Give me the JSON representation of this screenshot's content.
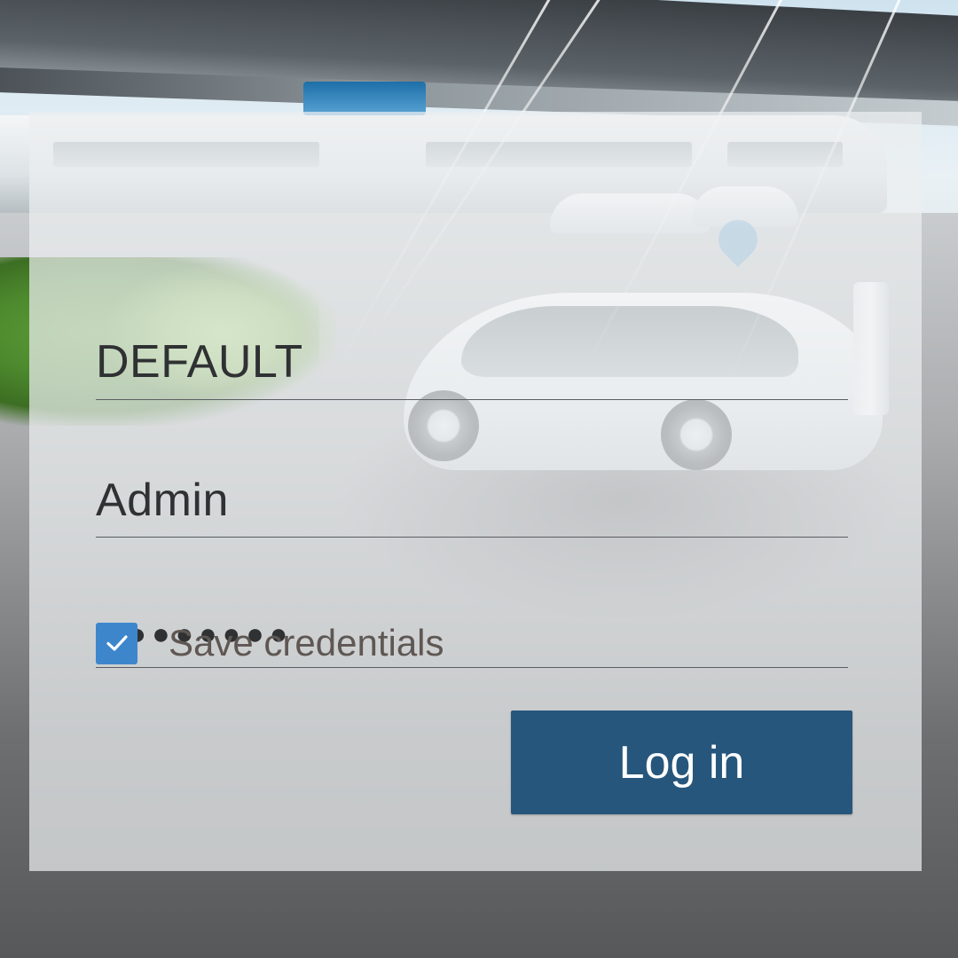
{
  "login_form": {
    "profile_value": "DEFAULT",
    "username_value": "Admin",
    "password_masked": "●●●●●●●●",
    "save_credentials": {
      "label": "Save credentials",
      "checked": true
    },
    "login_button_label": "Log in"
  },
  "colors": {
    "panel_overlay": "#eceef0",
    "button_background": "#27567d",
    "checkbox_background": "#3d86cc",
    "field_text": "#2f3133",
    "label_text": "#5f5753"
  },
  "icons": {
    "checkbox_mark": "checkmark-icon"
  }
}
